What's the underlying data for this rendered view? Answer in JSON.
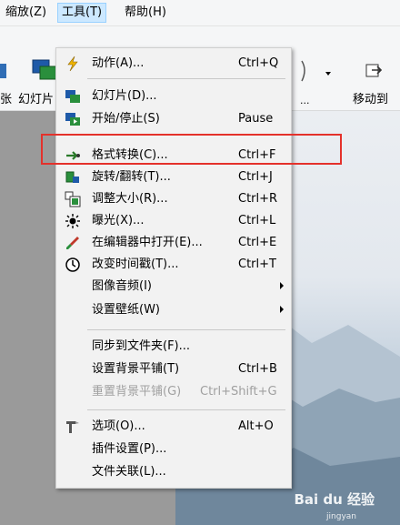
{
  "menubar": {
    "zoom": "缩放(Z)",
    "tools": "工具(T)",
    "help": "帮助(H)"
  },
  "toolbar": {
    "label_partial_left": "张",
    "label_slideshow": "幻灯片",
    "label_partial_right": "...",
    "label_move_to": "移动到"
  },
  "tools_menu": {
    "items": [
      {
        "label": "动作(A)...",
        "shortcut": "Ctrl+Q"
      },
      {
        "label": "幻灯片(D)...",
        "shortcut": ""
      },
      {
        "label": "开始/停止(S)",
        "shortcut": "Pause"
      },
      {
        "label": "格式转换(C)...",
        "shortcut": "Ctrl+F"
      },
      {
        "label": "旋转/翻转(T)...",
        "shortcut": "Ctrl+J"
      },
      {
        "label": "调整大小(R)...",
        "shortcut": "Ctrl+R"
      },
      {
        "label": "曝光(X)...",
        "shortcut": "Ctrl+L"
      },
      {
        "label": "在编辑器中打开(E)...",
        "shortcut": "Ctrl+E"
      },
      {
        "label": "改变时间戳(T)...",
        "shortcut": "Ctrl+T"
      },
      {
        "label": "图像音频(I)",
        "shortcut": ""
      },
      {
        "label": "设置壁纸(W)",
        "shortcut": ""
      },
      {
        "label": "同步到文件夹(F)...",
        "shortcut": ""
      },
      {
        "label": "设置背景平铺(T)",
        "shortcut": "Ctrl+B"
      },
      {
        "label": "重置背景平铺(G)",
        "shortcut": "Ctrl+Shift+G"
      },
      {
        "label": "选项(O)...",
        "shortcut": "Alt+O"
      },
      {
        "label": "插件设置(P)...",
        "shortcut": ""
      },
      {
        "label": "文件关联(L)...",
        "shortcut": ""
      }
    ]
  },
  "watermark": {
    "brand": "Bai du 经验",
    "sub": "jingyan"
  },
  "colors": {
    "highlight_box": "#e4312b",
    "menu_active_bg": "#cce8ff",
    "menu_bg": "#f2f2f2"
  }
}
